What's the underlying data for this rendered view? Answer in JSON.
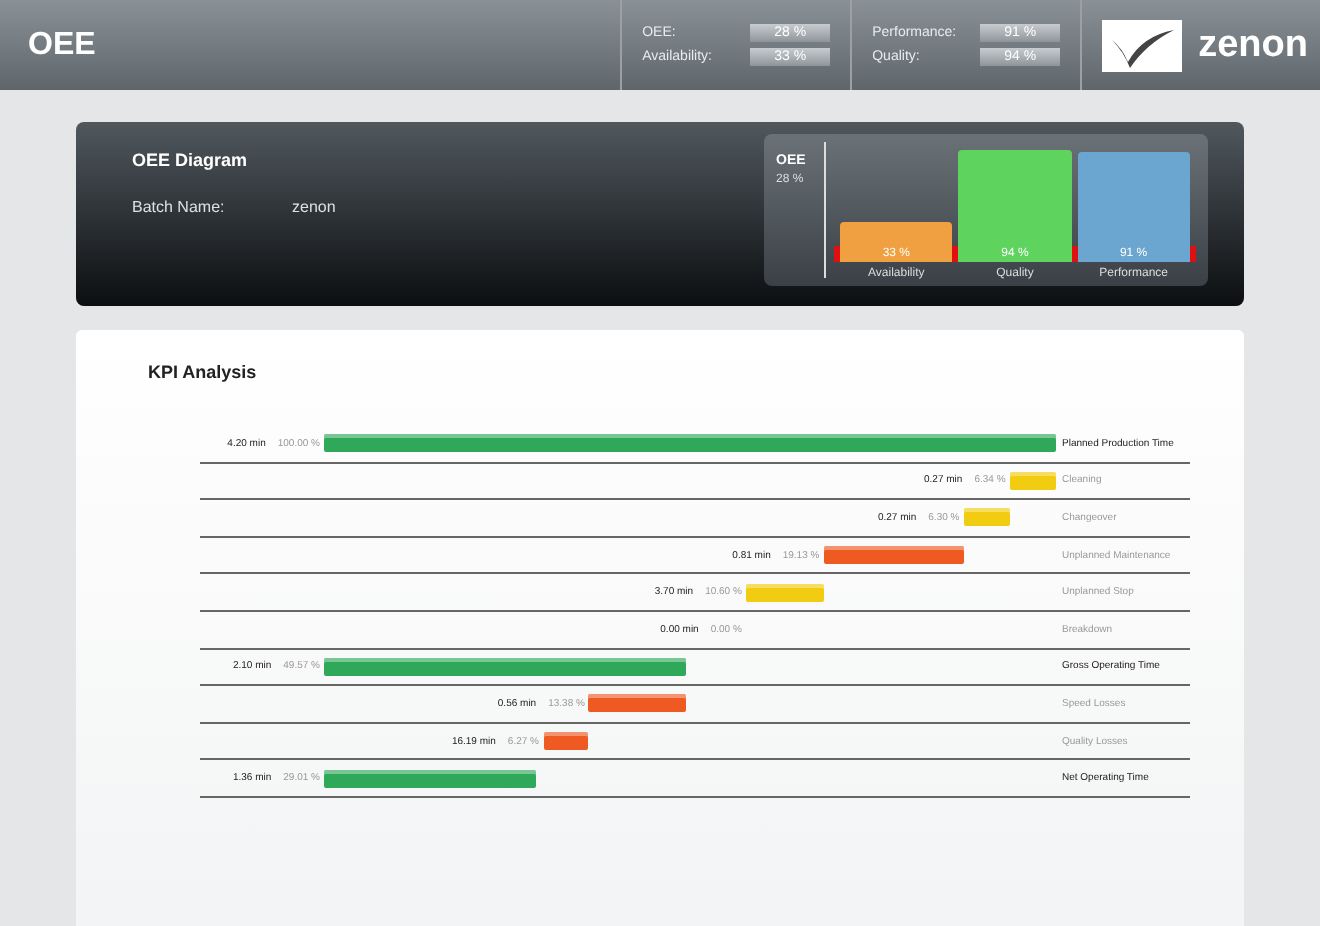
{
  "header": {
    "title": "OEE",
    "kpis": [
      {
        "label": "OEE:",
        "value": "28 %"
      },
      {
        "label": "Availability:",
        "value": "33 %"
      },
      {
        "label": "Performance:",
        "value": "91 %"
      },
      {
        "label": "Quality:",
        "value": "94 %"
      }
    ],
    "logo_text": "zenon"
  },
  "diagram": {
    "title": "OEE Diagram",
    "batch_label": "Batch Name:",
    "batch_value": "zenon",
    "oee_label": "OEE",
    "oee_value": "28 %",
    "bars": [
      {
        "label": "Availability",
        "value": "33 %",
        "color": "#f0a040"
      },
      {
        "label": "Quality",
        "value": "94 %",
        "color": "#5ed45e"
      },
      {
        "label": "Performance",
        "value": "91 %",
        "color": "#6aa6d0"
      }
    ]
  },
  "kpi": {
    "title": "KPI Analysis",
    "rows": [
      {
        "kind": "total",
        "minutes": "4.20 min",
        "percent": "100.00 %",
        "color": "#2fa85a",
        "label": "Planned Production Time"
      },
      {
        "kind": "loss",
        "minutes": "0.27 min",
        "percent": "6.34 %",
        "color": "#f2cc10",
        "label": "Cleaning"
      },
      {
        "kind": "loss",
        "minutes": "0.27 min",
        "percent": "6.30 %",
        "color": "#f2cc10",
        "label": "Changeover"
      },
      {
        "kind": "loss",
        "minutes": "0.81 min",
        "percent": "19.13 %",
        "color": "#ef5a22",
        "label": "Unplanned Maintenance"
      },
      {
        "kind": "loss",
        "minutes": "3.70 min",
        "percent": "10.60 %",
        "color": "#f2cc10",
        "label": "Unplanned Stop"
      },
      {
        "kind": "loss",
        "minutes": "0.00 min",
        "percent": "0.00 %",
        "label": "Breakdown"
      },
      {
        "kind": "total",
        "minutes": "2.10 min",
        "percent": "49.57 %",
        "color": "#2fa85a",
        "label": "Gross Operating Time"
      },
      {
        "kind": "loss",
        "minutes": "0.56 min",
        "percent": "13.38 %",
        "color": "#ef5a22",
        "label": "Speed Losses"
      },
      {
        "kind": "loss",
        "minutes": "16.19 min",
        "percent": "6.27 %",
        "color": "#ef5a22",
        "label": "Quality Losses"
      },
      {
        "kind": "total",
        "minutes": "1.36 min",
        "percent": "29.01 %",
        "color": "#2fa85a",
        "label": "Net Operating Time"
      }
    ]
  }
}
